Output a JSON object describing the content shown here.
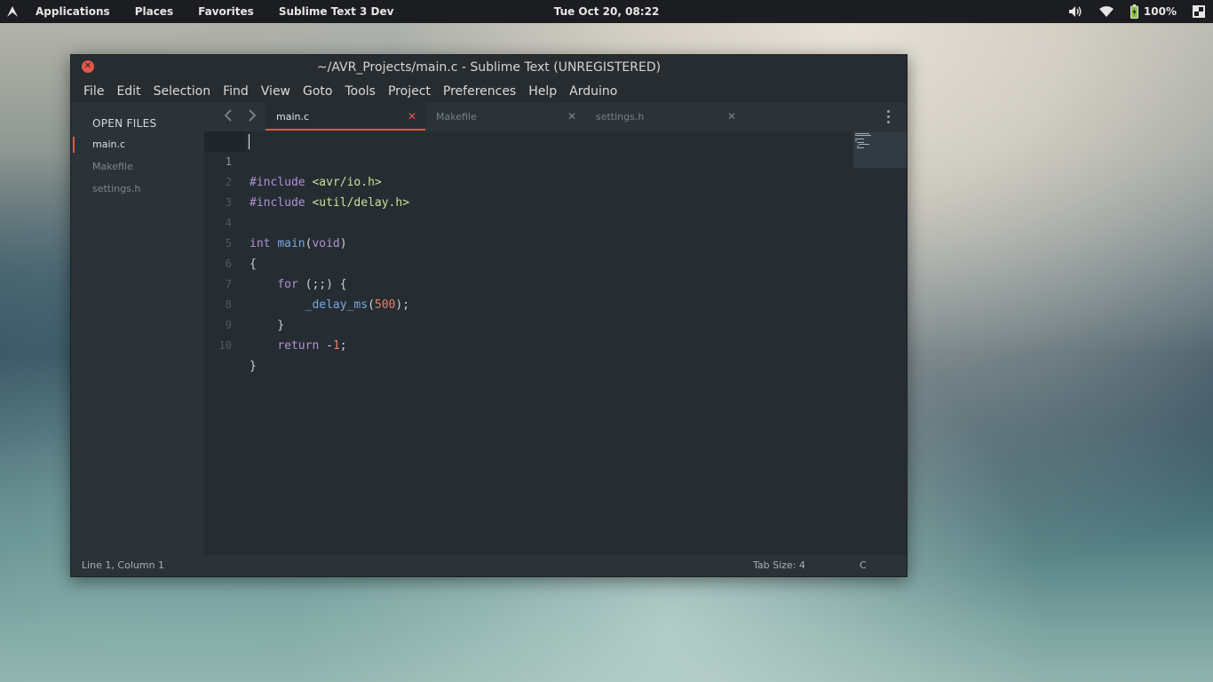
{
  "top_panel": {
    "menu": [
      "Applications",
      "Places",
      "Favorites",
      "Sublime Text 3 Dev"
    ],
    "clock": "Tue Oct 20, 08:22",
    "battery": "100%",
    "icons": [
      "arch-logo-icon",
      "volume-icon",
      "wifi-icon",
      "battery-icon",
      "session-icon"
    ]
  },
  "window": {
    "title": "~/AVR_Projects/main.c - Sublime Text (UNREGISTERED)",
    "menu": [
      "File",
      "Edit",
      "Selection",
      "Find",
      "View",
      "Goto",
      "Tools",
      "Project",
      "Preferences",
      "Help",
      "Arduino"
    ]
  },
  "sidebar": {
    "heading": "OPEN FILES",
    "files": [
      "main.c",
      "Makefile",
      "settings.h"
    ],
    "active_index": 0
  },
  "tabs": [
    {
      "label": "main.c",
      "active": true
    },
    {
      "label": "Makefile",
      "active": false
    },
    {
      "label": "settings.h",
      "active": false
    }
  ],
  "editor": {
    "line_numbers": [
      "1",
      "2",
      "3",
      "4",
      "5",
      "6",
      "7",
      "8",
      "9",
      "10"
    ],
    "current_line": 1
  },
  "statusbar": {
    "position": "Line 1, Column 1",
    "tab_size": "Tab Size: 4",
    "syntax": "C"
  },
  "colors": {
    "accent": "#e2574c",
    "editor_bg": "#262d32",
    "keyword": "#b191d4",
    "function": "#76a8de",
    "string": "#c8e19b",
    "number": "#ec7b6a"
  }
}
